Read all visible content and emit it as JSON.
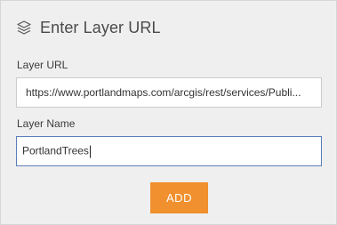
{
  "dialog": {
    "title": "Enter Layer URL",
    "icon": "layers-icon"
  },
  "layer_url": {
    "label": "Layer URL",
    "value": "https://www.portlandmaps.com/arcgis/rest/services/Publi..."
  },
  "layer_name": {
    "label": "Layer Name",
    "value": "PortlandTrees"
  },
  "actions": {
    "add_label": "ADD"
  },
  "colors": {
    "panel_bg": "#efefef",
    "accent": "#f0902e",
    "focus_border": "#5b7fb8"
  }
}
